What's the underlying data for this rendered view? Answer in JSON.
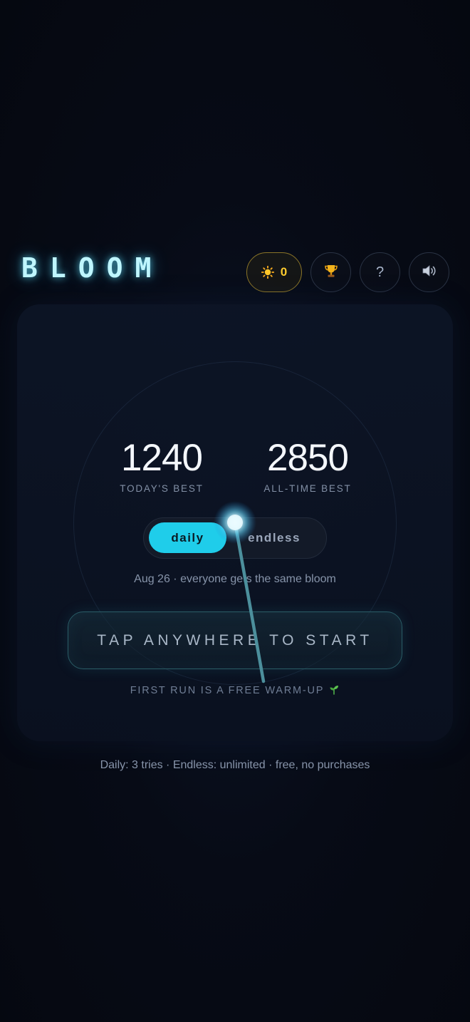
{
  "header": {
    "logo": "BLOOM",
    "sun_count": "0",
    "icons": {
      "sun": "sun-icon",
      "trophy": "trophy-icon",
      "help": "?",
      "sound": "speaker-icon"
    }
  },
  "scores": {
    "today_value": "1240",
    "today_label": "TODAY'S BEST",
    "alltime_value": "2850",
    "alltime_label": "ALL-TIME BEST"
  },
  "mode": {
    "options": [
      "daily",
      "endless"
    ],
    "selected": "daily"
  },
  "daily_note": "Aug 26 · everyone gets the same bloom",
  "start_button": "TAP ANYWHERE TO START",
  "warmup_note": "FIRST RUN IS A FREE WARM-UP",
  "footer_note": "Daily: 3 tries · Endless: unlimited · free, no purchases",
  "colors": {
    "accent": "#1fcdea",
    "logo_glow": "#5fe1ff",
    "sun": "#ffcc2e",
    "background": "#060912"
  }
}
